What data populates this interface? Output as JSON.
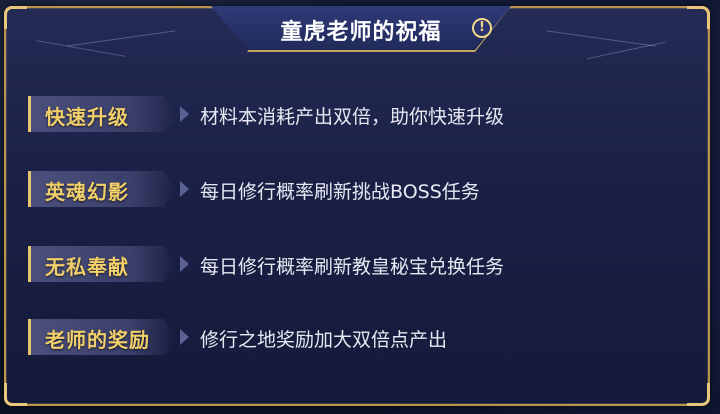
{
  "title": "童虎老师的祝福",
  "info_icon": "info-icon",
  "colors": {
    "gold_border": "#b9954c",
    "tag_text": "#f1cf6a",
    "desc_text": "#e6e8f2",
    "panel_bg": "#1b2146"
  },
  "rows": [
    {
      "tag": "快速升级",
      "desc": "材料本消耗产出双倍，助你快速升级"
    },
    {
      "tag": "英魂幻影",
      "desc": "每日修行概率刷新挑战BOSS任务"
    },
    {
      "tag": "无私奉献",
      "desc": "每日修行概率刷新教皇秘宝兑换任务"
    },
    {
      "tag": "老师的奖励",
      "desc": "修行之地奖励加大双倍点产出"
    }
  ]
}
